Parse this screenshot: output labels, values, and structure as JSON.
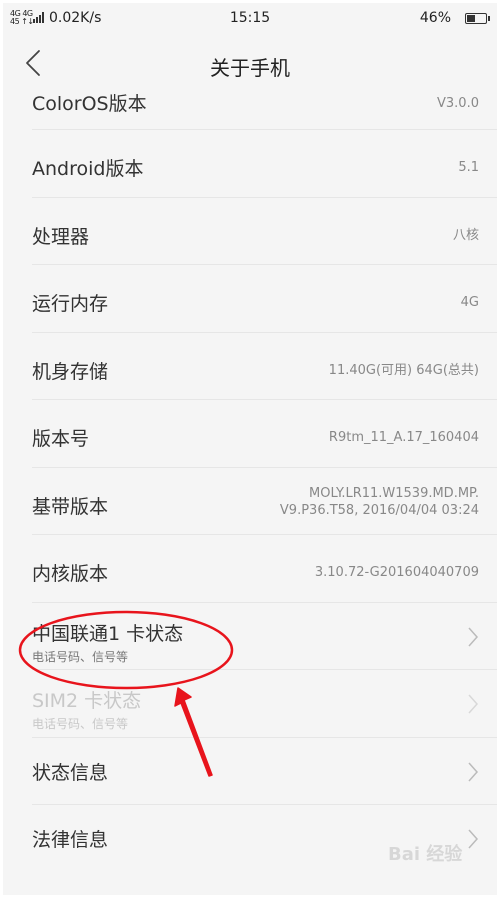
{
  "status_bar": {
    "network_top": "4G 4G",
    "network_bottom": "45 ↑↓",
    "speed": "0.02K/s",
    "time": "15:15",
    "battery": "46%",
    "battery_level": 0.46
  },
  "header": {
    "title": "关于手机"
  },
  "items": [
    {
      "label": "ColorOS版本",
      "value": "V3.0.0"
    },
    {
      "label": "Android版本",
      "value": "5.1"
    },
    {
      "label": "处理器",
      "value": "八核"
    },
    {
      "label": "运行内存",
      "value": "4G"
    },
    {
      "label": "机身存储",
      "value": "11.40G(可用)  64G(总共)"
    },
    {
      "label": "版本号",
      "value": "R9tm_11_A.17_160404"
    },
    {
      "label": "基带版本",
      "value": "MOLY.LR11.W1539.MD.MP.",
      "value2": "V9.P36.T58, 2016/04/04 03:24"
    },
    {
      "label": "内核版本",
      "value": "3.10.72-G201604040709"
    },
    {
      "label": "中国联通1 卡状态",
      "sub": "电话号码、信号等"
    },
    {
      "label": "SIM2 卡状态",
      "sub": "电话号码、信号等"
    },
    {
      "label": "状态信息"
    },
    {
      "label": "法律信息"
    }
  ],
  "watermark": "Bai  经验",
  "colors": {
    "annotation": "#e8141c",
    "background": "#f5f5f5",
    "divider": "#e6e6e6"
  }
}
